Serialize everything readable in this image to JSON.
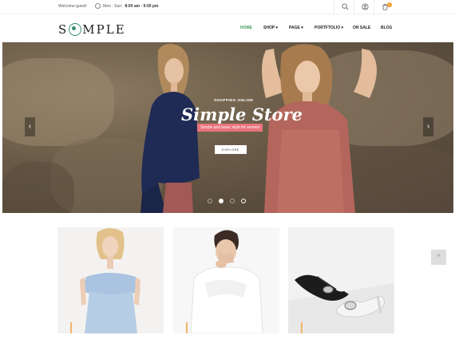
{
  "topbar": {
    "welcome": "Welcome guest!",
    "hours_label": "Mon - Sun:",
    "hours_value": "8:00 am - 9:00 pm",
    "cart_count": "0"
  },
  "header": {
    "logo_prefix": "S",
    "logo_suffix": "MPLE",
    "nav": [
      {
        "label": "HOME"
      },
      {
        "label": "SHOP ▾"
      },
      {
        "label": "PAGE ▾"
      },
      {
        "label": "PORTFTOLIO ▾"
      },
      {
        "label": "ON SALE"
      },
      {
        "label": "BLOG"
      }
    ]
  },
  "hero": {
    "subtitle": "SHOPPING ONLINE",
    "title": "Simple Store",
    "badge": "Simple and basic style for women",
    "button": "EXPLORE",
    "prev_arrow": "‹",
    "next_arrow": "›"
  },
  "scroll_top": "^",
  "colors": {
    "accent_green": "#3f9a5b",
    "badge_pink": "#e9737c",
    "cart_orange": "#f29c1f"
  }
}
